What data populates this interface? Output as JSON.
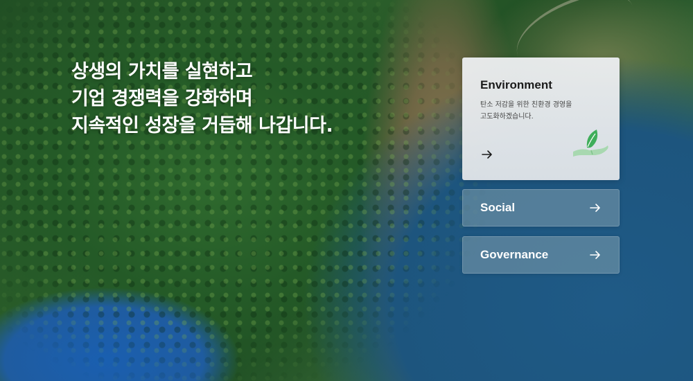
{
  "hero": {
    "headline": [
      "상생의 가치를 실현하고",
      "기업 경쟁력을 강화하며",
      "지속적인 성장을 거듭해 나갑니다."
    ]
  },
  "cards": {
    "environment": {
      "title": "Environment",
      "description": [
        "탄소 저감을 위한 친환경 경영을",
        "고도화하겠습니다."
      ],
      "icon": "leaf-hand-icon"
    },
    "social": {
      "title": "Social"
    },
    "governance": {
      "title": "Governance"
    }
  },
  "colors": {
    "leaf": "#3fae5a",
    "card_environment_bg": "#e8eaec",
    "card_small_bg": "#8eaab5"
  }
}
